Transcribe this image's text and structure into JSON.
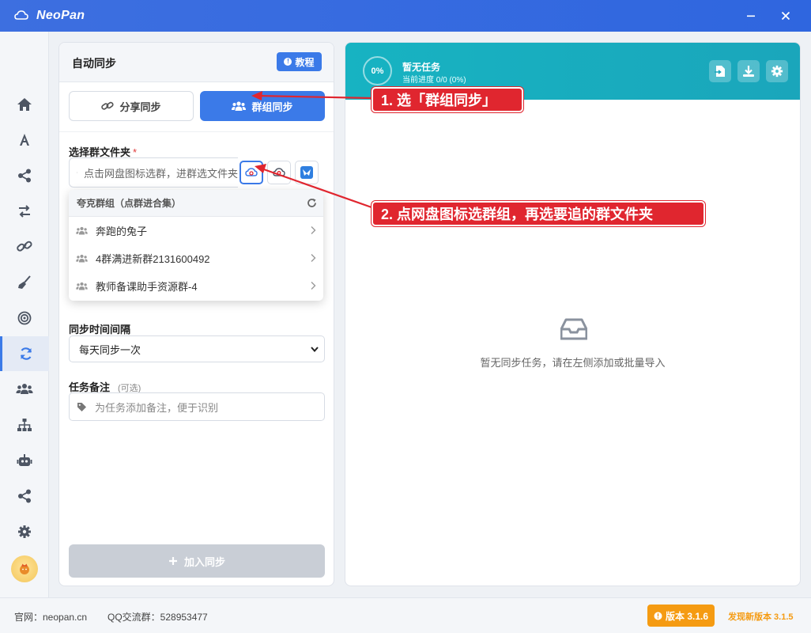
{
  "app": {
    "title": "NeoPan",
    "minimize_icon": "minimize-icon",
    "close_icon": "close-icon"
  },
  "nav": {
    "items": [
      "home-icon",
      "font-icon",
      "share-icon",
      "transfer-icon",
      "link-icon",
      "broom-icon",
      "target-icon",
      "sync-icon",
      "group-icon",
      "sitemap-icon",
      "robot-icon",
      "share-icon",
      "gear-icon"
    ],
    "active": "sync-icon"
  },
  "panel": {
    "title": "自动同步",
    "tutorial_label": "教程",
    "mode_share_label": "分享同步",
    "mode_group_label": "群组同步",
    "folder_label": "选择群文件夹",
    "required_mark": "*",
    "folder_placeholder": "点击网盘图标选群，进群选文件夹",
    "interval_label": "同步时间间隔",
    "interval_value": "每天同步一次",
    "note_label": "任务备注",
    "note_optional": "(可选)",
    "note_placeholder": "为任务添加备注，便于识别",
    "add_label": "加入同步"
  },
  "dropdown": {
    "header": "夸克群组（点群进合集）",
    "groups": [
      "奔跑的兔子",
      "4群满进新群2131600492",
      "教师备课助手资源群-4"
    ]
  },
  "task_panel": {
    "progress_percent": "0%",
    "status": "暂无任务",
    "progress_text": "当前进度 0/0 (0%)",
    "empty_text": "暂无同步任务，请在左侧添加或批量导入"
  },
  "footer": {
    "site": "官网：neopan.cn",
    "qq": "QQ交流群：528953477",
    "version": "版本 3.1.6",
    "new_version": "发现新版本 3.1.5"
  },
  "annotations": {
    "step1": "1. 选「群组同步」",
    "step2": "2. 点网盘图标选群组，再选要追的群文件夹"
  },
  "colors": {
    "primary": "#3b7ae8",
    "teal": "#17b3c2",
    "warning": "#f59b12",
    "annotation": "#e0262f"
  }
}
